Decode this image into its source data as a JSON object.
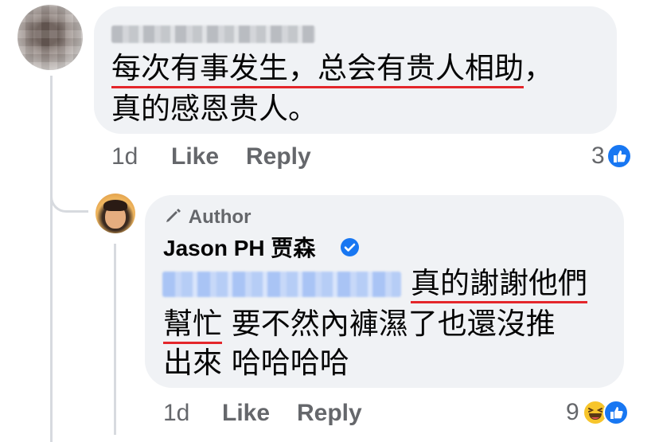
{
  "comment_1": {
    "line_1_underlined": "每次有事发生，总会有贵人相助",
    "line_1_end": "，",
    "line_2": "真的感恩贵人。",
    "time": "1d",
    "like_label": "Like",
    "reply_label": "Reply",
    "reaction_count": "3",
    "reaction_icons": [
      "like-icon"
    ]
  },
  "comment_2": {
    "author_badge": "Author",
    "name": "Jason PH 贾森",
    "verified": true,
    "line_1_underlined": "真的謝謝他們",
    "line_2_underlined": "幫忙",
    "line_2_rest": " 要不然內褲濕了也還沒推",
    "line_3": "出來 哈哈哈哈",
    "time": "1d",
    "like_label": "Like",
    "reply_label": "Reply",
    "reaction_count": "9",
    "reaction_icons": [
      "haha-icon",
      "like-icon"
    ]
  },
  "colors": {
    "bubble": "#f0f2f5",
    "underline": "#e4262b",
    "meta_text": "#65676b",
    "facebook_blue": "#1877f2",
    "thread_line": "#d7dadf"
  }
}
